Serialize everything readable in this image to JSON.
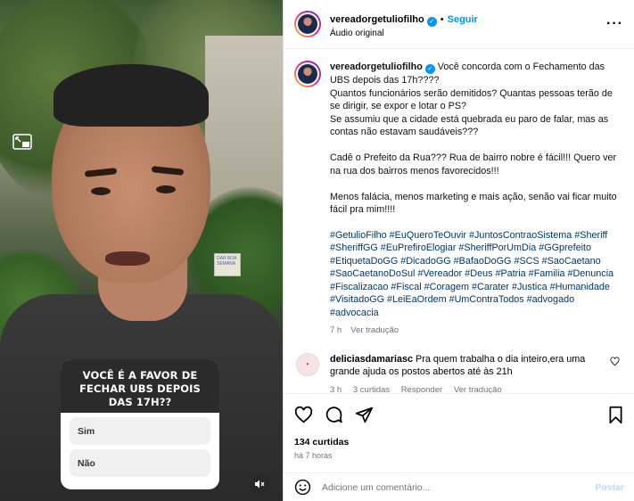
{
  "video": {
    "sign_text": "DAR BOA SEMANA",
    "poll": {
      "question": "VOCÊ É A FAVOR DE FECHAR UBS DEPOIS DAS 17H??",
      "options": [
        "Sim",
        "Não"
      ]
    },
    "icons": [
      "picture-in-picture-icon",
      "mute-icon"
    ]
  },
  "header": {
    "username": "vereadorgetuliofilho",
    "dot": "•",
    "follow_label": "Seguir",
    "audio": "Áudio original",
    "more": "···"
  },
  "caption": {
    "username": "vereadorgetuliofilho",
    "text": "Você concorda com o Fechamento das UBS depois das 17h????\nQuantos funcionários serão demitidos? Quantas pessoas terão de se dirigir, se expor e lotar o PS?\nSe assumiu que a cidade está quebrada eu paro de falar, mas as contas não estavam saudáveis???\n\nCadê o Prefeito da Rua??? Rua de bairro nobre é fácil!!! Quero ver na rua dos bairros menos favorecidos!!!\n\nMenos falácia, menos marketing e mais ação, senão vai ficar muito fácil pra mim!!!!",
    "hashtags": "#GetulioFilho #EuQueroTeOuvir #JuntosContraoSistema #Sheriff #SheriffGG #EuPrefiroElogiar #SheriffPorUmDia #GGprefeito #EtiquetaDoGG #DicadoGG #BafaoDoGG #SCS #SaoCaetano #SaoCaetanoDoSul #Vereador #Deus #Patria #Familia #Denuncia #Fiscalizacao #Fiscal #Coragem #Carater #Justica #Humanidade #VisitadoGG #LeiEaOrdem #UmContraTodos #advogado #advocacia",
    "time": "7 h",
    "translate": "Ver tradução"
  },
  "comment": {
    "username": "deliciasdamariasc",
    "text": "Pra quem trabalha o dia inteiro,era uma grande ajuda os postos abertos até às 21h",
    "time": "3 h",
    "likes": "3 curtidas",
    "reply": "Responder",
    "translate": "Ver tradução"
  },
  "actions": {
    "icons": [
      "heart-icon",
      "comment-icon",
      "share-icon",
      "bookmark-icon"
    ],
    "likes": "134 curtidas",
    "time": "há 7 horas"
  },
  "add_comment": {
    "placeholder": "Adicione um comentário...",
    "post_label": "Postar"
  }
}
